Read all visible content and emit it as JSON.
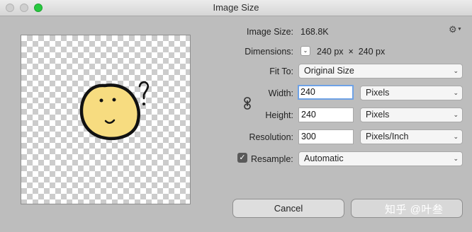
{
  "window": {
    "title": "Image Size"
  },
  "info": {
    "image_size_label": "Image Size:",
    "image_size_value": "168.8K",
    "dimensions_label": "Dimensions:",
    "dimensions_value": "240 px  ×  240 px"
  },
  "form": {
    "fit_to_label": "Fit To:",
    "fit_to_value": "Original Size",
    "width_label": "Width:",
    "width_value": "240",
    "width_unit": "Pixels",
    "height_label": "Height:",
    "height_value": "240",
    "height_unit": "Pixels",
    "resolution_label": "Resolution:",
    "resolution_value": "300",
    "resolution_unit": "Pixels/Inch",
    "resample_label": "Resample:",
    "resample_checked": true,
    "resample_value": "Automatic"
  },
  "buttons": {
    "cancel": "Cancel"
  },
  "watermark": "知乎 @叶叁",
  "icons": {
    "settings": "gear-icon",
    "dimensions_toggle": "chevron-down-icon",
    "constrain": "link-icon",
    "checkbox": "checkmark-icon"
  },
  "colors": {
    "focus_ring": "#6ea2e6",
    "zoom_button": "#27c93f"
  }
}
